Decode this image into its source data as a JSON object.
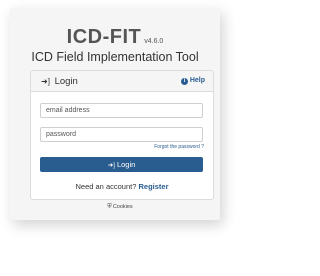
{
  "app": {
    "name": "ICD-FIT",
    "version": "v4.6.0",
    "tagline": "ICD Field Implementation Tool"
  },
  "login_panel": {
    "title": "Login",
    "title_icon": "sign-in-icon",
    "help_label": "Help",
    "help_icon": "info-circle-icon",
    "email_placeholder": "email address",
    "password_placeholder": "password",
    "forgot_password": "Forgot the password ?",
    "login_button": "Login",
    "need_account": "Need an account?",
    "register_link": "Register"
  },
  "footer": {
    "cookies_label": "Cookies",
    "cookies_icon": "shield-icon"
  },
  "colors": {
    "accent": "#2a5d8f",
    "background": "#f5f5f5",
    "text": "#333333"
  }
}
